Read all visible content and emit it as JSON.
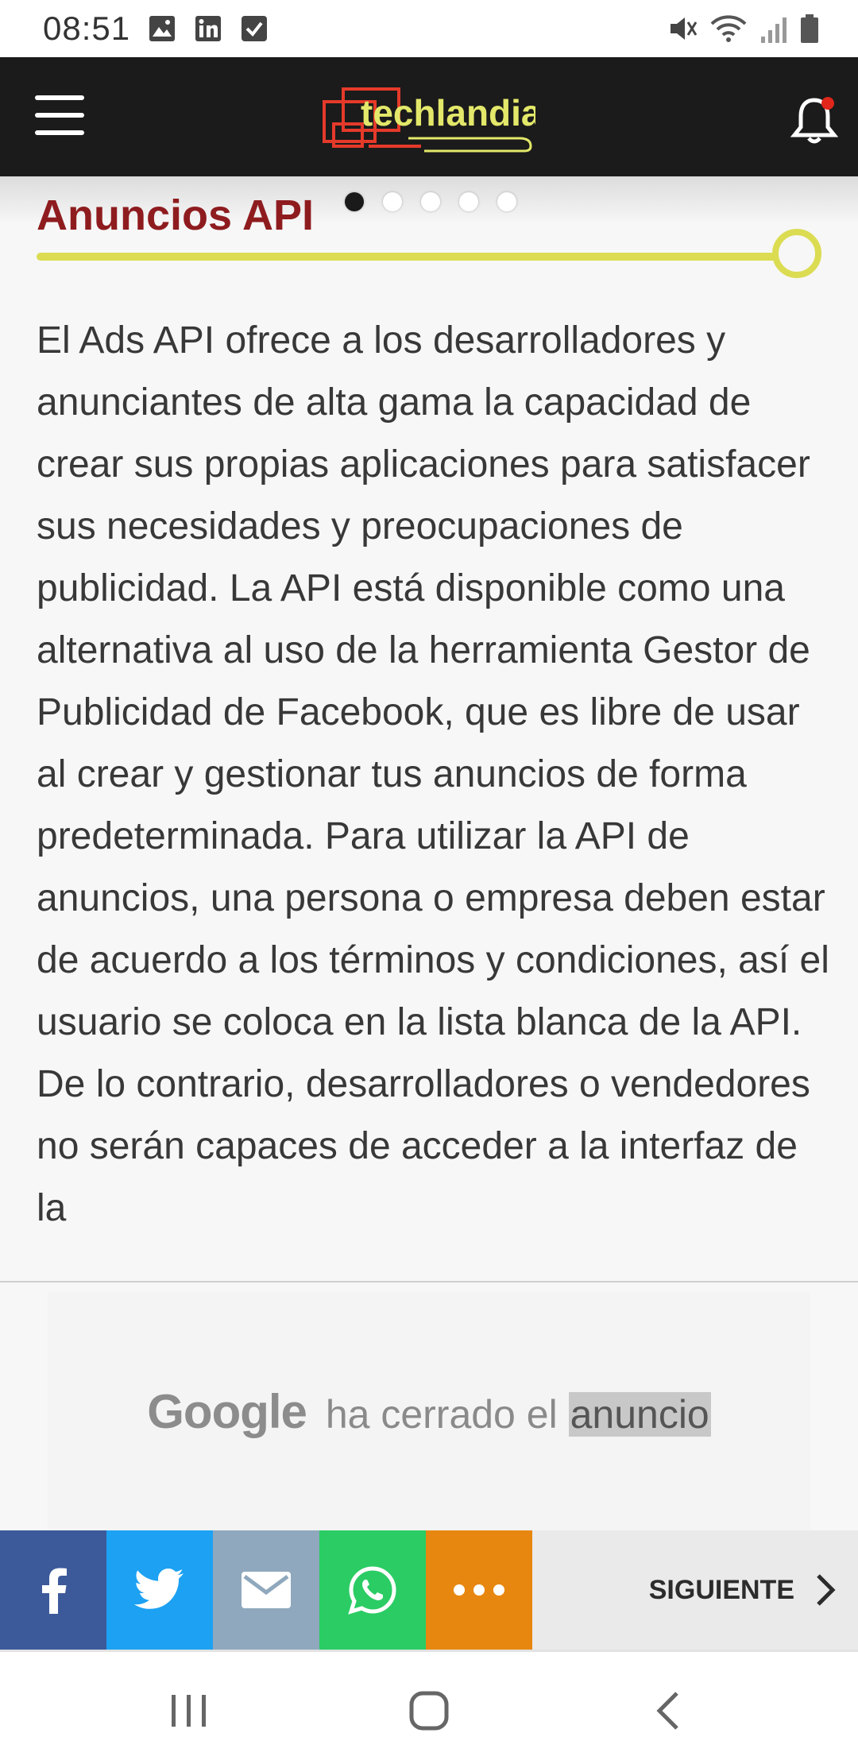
{
  "status_bar": {
    "time": "08:51",
    "left_icons": [
      "gallery-icon",
      "linkedin-icon",
      "checkbox-icon"
    ],
    "right_icons": [
      "mute-icon",
      "wifi-icon",
      "signal-icon",
      "battery-icon"
    ]
  },
  "header": {
    "logo_text": "techlandia",
    "menu_icon": "hamburger-icon",
    "notification_icon": "bell-icon"
  },
  "carousel": {
    "dot_count": 5,
    "active_index": 0
  },
  "article": {
    "title": "Anuncios API",
    "body": "El Ads API ofrece a los desarrolladores y anunciantes de alta gama la capacidad de crear sus propias aplicaciones para satisfacer sus necesidades y preocupaciones de publicidad. La API está disponible como una alternativa al uso de la herramienta Gestor de Publicidad de Facebook, que es libre de usar al crear y gestionar tus anuncios de forma predeterminada. Para utilizar la API de anuncios, una persona o empresa deben estar de acuerdo a los términos y condiciones, así el usuario se coloca en la lista blanca de la API. De lo contrario, desarrolladores o vendedores no serán capaces de acceder a la interfaz de la"
  },
  "ad": {
    "brand": "Google",
    "message": "ha cerrado el",
    "highlight": "anuncio"
  },
  "share_bar": {
    "buttons": [
      "facebook-icon",
      "twitter-icon",
      "mail-icon",
      "whatsapp-icon",
      "more-icon"
    ],
    "next_label": "SIGUIENTE"
  },
  "colors": {
    "title": "#8e1c1f",
    "accent_line": "#dbdc52",
    "facebook": "#3c5a9a",
    "twitter": "#1da1f2",
    "mail": "#8fa8bd",
    "whatsapp": "#2bcc64",
    "more": "#e78710"
  },
  "nav_bar": {
    "buttons": [
      "recents-icon",
      "home-icon",
      "back-icon"
    ]
  }
}
